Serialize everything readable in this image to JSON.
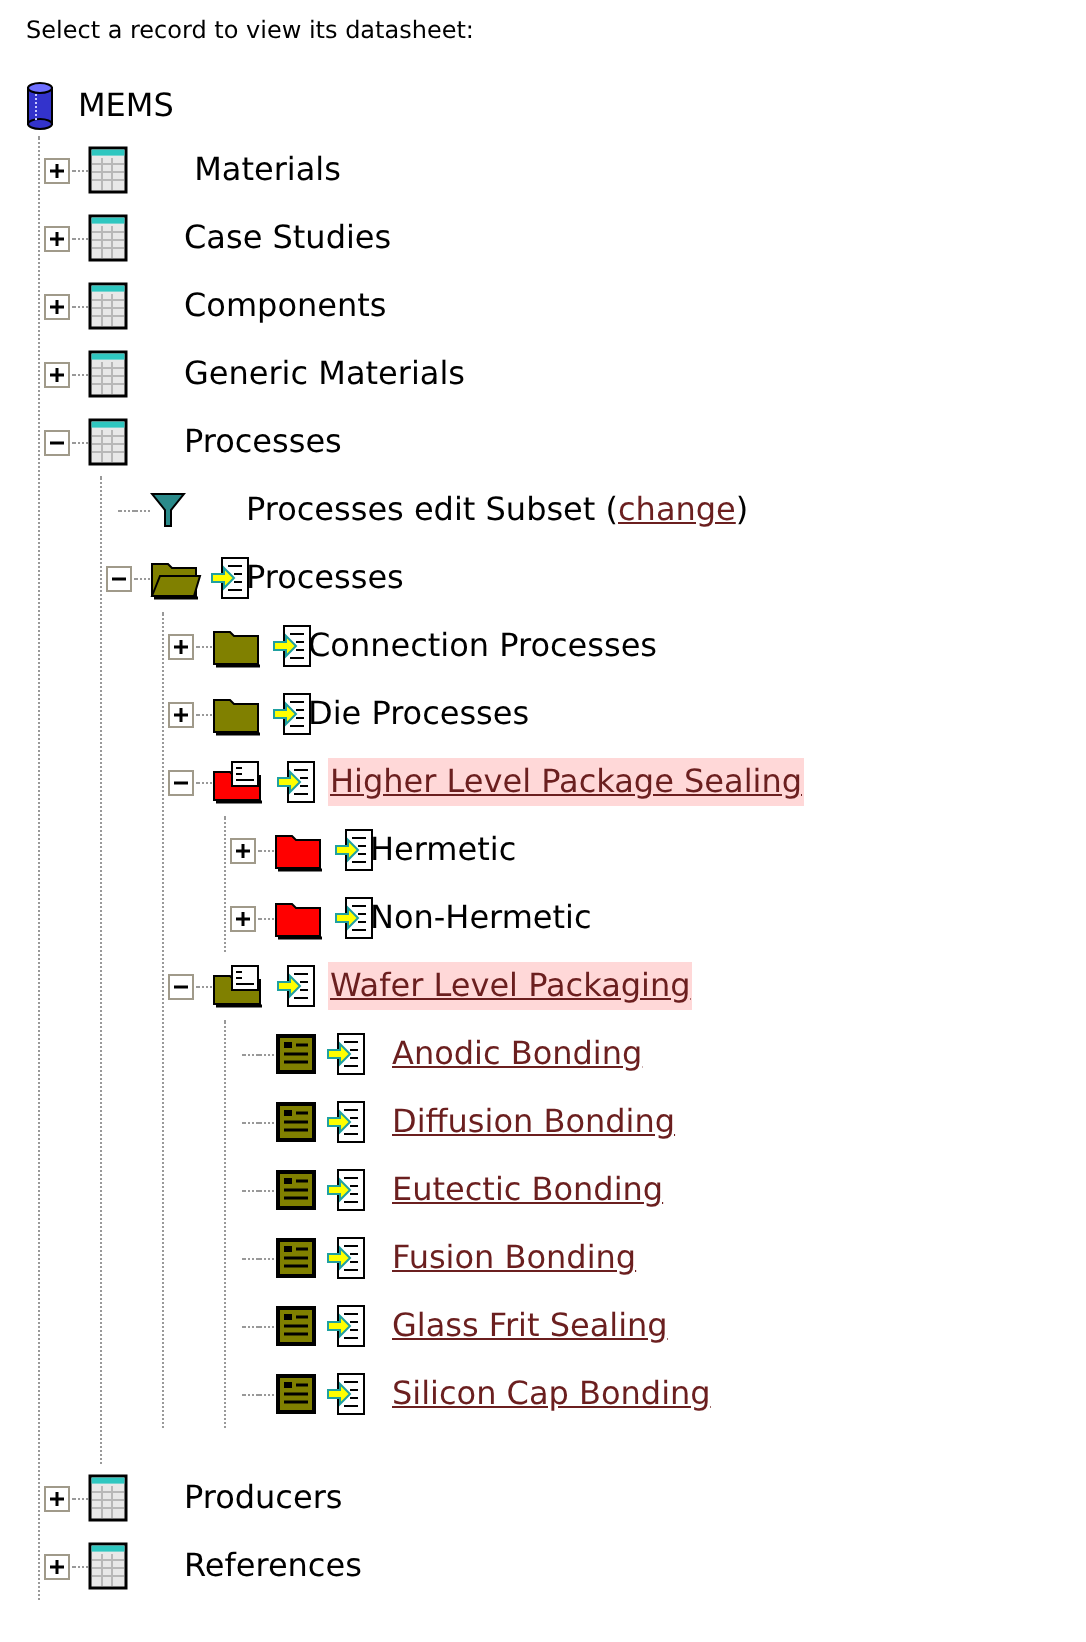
{
  "heading": "Select a record to view its datasheet:",
  "root": {
    "label": "MEMS",
    "children": [
      {
        "kind": "table",
        "label": " Materials",
        "expanded": false
      },
      {
        "kind": "table",
        "label": "Case Studies",
        "expanded": false
      },
      {
        "kind": "table",
        "label": "Components",
        "expanded": false
      },
      {
        "kind": "table",
        "label": "Generic Materials",
        "expanded": false
      },
      {
        "kind": "table",
        "label": "Processes",
        "expanded": true,
        "children": [
          {
            "kind": "filter",
            "label": "Processes edit Subset (",
            "link": "change",
            "after": ")"
          },
          {
            "kind": "folder",
            "label": "Processes",
            "expanded": true,
            "color": "#808000",
            "children": [
              {
                "kind": "folder",
                "label": "Connection Processes",
                "expanded": false,
                "color": "#808000"
              },
              {
                "kind": "folder",
                "label": "Die Processes",
                "expanded": false,
                "color": "#808000"
              },
              {
                "kind": "record-folder",
                "label": "Higher Level Package Sealing",
                "expanded": true,
                "highlighted": true,
                "color": "#ff0000",
                "children": [
                  {
                    "kind": "folder",
                    "label": "Hermetic",
                    "expanded": false,
                    "color": "#ff0000"
                  },
                  {
                    "kind": "folder",
                    "label": "Non-Hermetic",
                    "expanded": false,
                    "color": "#ff0000"
                  }
                ]
              },
              {
                "kind": "record-folder",
                "label": "Wafer Level Packaging",
                "expanded": true,
                "highlighted": true,
                "color": "#808000",
                "children": [
                  {
                    "kind": "record",
                    "label": "Anodic Bonding"
                  },
                  {
                    "kind": "record",
                    "label": "Diffusion Bonding"
                  },
                  {
                    "kind": "record",
                    "label": "Eutectic Bonding"
                  },
                  {
                    "kind": "record",
                    "label": "Fusion Bonding"
                  },
                  {
                    "kind": "record",
                    "label": "Glass Frit Sealing"
                  },
                  {
                    "kind": "record",
                    "label": "Silicon Cap Bonding"
                  }
                ]
              }
            ]
          }
        ]
      },
      {
        "kind": "table",
        "label": "Producers",
        "expanded": false
      },
      {
        "kind": "table",
        "label": "References",
        "expanded": false
      }
    ]
  }
}
